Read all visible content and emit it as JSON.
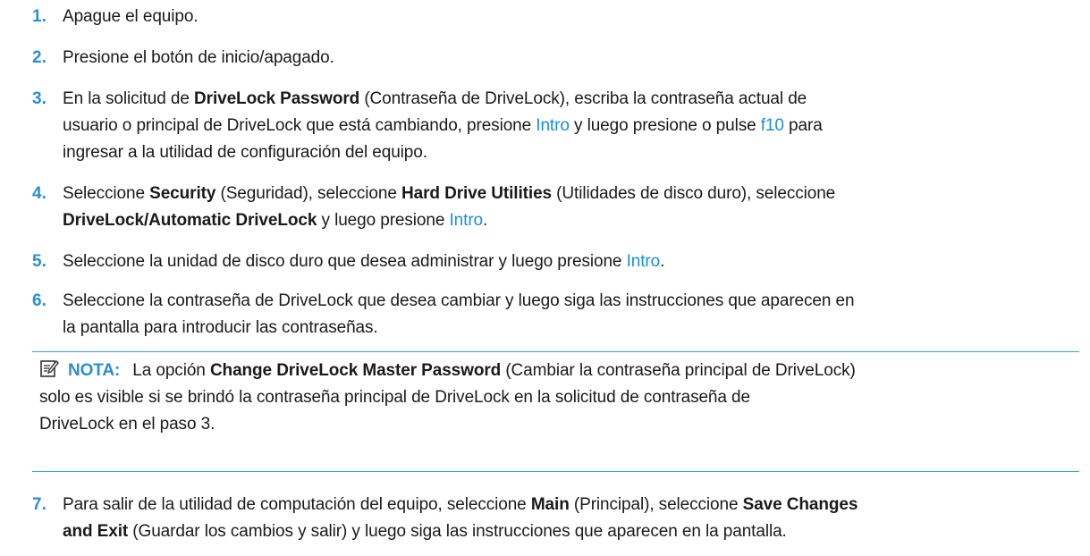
{
  "steps": [
    {
      "num": "1.",
      "parts": [
        {
          "t": "Apague el equipo."
        }
      ]
    },
    {
      "num": "2.",
      "parts": [
        {
          "t": "Presione el botón de inicio/apagado."
        }
      ]
    },
    {
      "num": "3.",
      "parts": [
        {
          "t": "En la solicitud de "
        },
        {
          "t": "DriveLock Password",
          "b": true
        },
        {
          "t": " (Contraseña de DriveLock), escriba la contraseña actual de"
        },
        {
          "br": true
        },
        {
          "t": "usuario o principal de DriveLock que está cambiando, presione "
        },
        {
          "t": "Intro",
          "k": true
        },
        {
          "t": " y luego presione o pulse "
        },
        {
          "t": "f10",
          "k": true
        },
        {
          "t": " para"
        },
        {
          "br": true
        },
        {
          "t": "ingresar a la utilidad de configuración del equipo."
        }
      ]
    },
    {
      "num": "4.",
      "parts": [
        {
          "t": "Seleccione "
        },
        {
          "t": "Security",
          "b": true
        },
        {
          "t": " (Seguridad), seleccione "
        },
        {
          "t": "Hard Drive Utilities",
          "b": true
        },
        {
          "t": " (Utilidades de disco duro), seleccione"
        },
        {
          "br": true
        },
        {
          "t": "DriveLock/Automatic DriveLock",
          "b": true
        },
        {
          "t": " y luego presione "
        },
        {
          "t": "Intro",
          "k": true
        },
        {
          "t": "."
        }
      ]
    },
    {
      "num": "5.",
      "parts": [
        {
          "t": "Seleccione la unidad de disco duro que desea administrar y luego presione "
        },
        {
          "t": "Intro",
          "k": true
        },
        {
          "t": "."
        }
      ]
    },
    {
      "num": "6.",
      "parts": [
        {
          "t": "Seleccione la contraseña de DriveLock que desea cambiar y luego siga las instrucciones que aparecen en"
        },
        {
          "br": true
        },
        {
          "t": "la pantalla para introducir las contraseñas."
        }
      ]
    },
    {
      "num": "7.",
      "parts": [
        {
          "t": "Para salir de la utilidad de computación del equipo, seleccione "
        },
        {
          "t": "Main",
          "b": true
        },
        {
          "t": " (Principal), seleccione "
        },
        {
          "t": "Save Changes",
          "b": true
        },
        {
          "br": true
        },
        {
          "t": "and Exit",
          "b": true
        },
        {
          "t": " (Guardar los cambios y salir) y luego siga las instrucciones que aparecen en la pantalla."
        }
      ]
    }
  ],
  "note": {
    "label": "NOTA:",
    "icon": "note-icon",
    "parts": [
      {
        "t": "La opción "
      },
      {
        "t": "Change DriveLock Master Password",
        "b": true
      },
      {
        "t": " (Cambiar la contraseña principal de DriveLock)"
      },
      {
        "br": true
      },
      {
        "t": "solo es visible si se brindó la contraseña principal de DriveLock en la solicitud de contraseña de"
      },
      {
        "br": true
      },
      {
        "t": "DriveLock en el paso 3."
      }
    ]
  },
  "colors": {
    "accent": "#2a8fd0",
    "key": "#1a8fd9",
    "rule": "#3aa0d8"
  }
}
